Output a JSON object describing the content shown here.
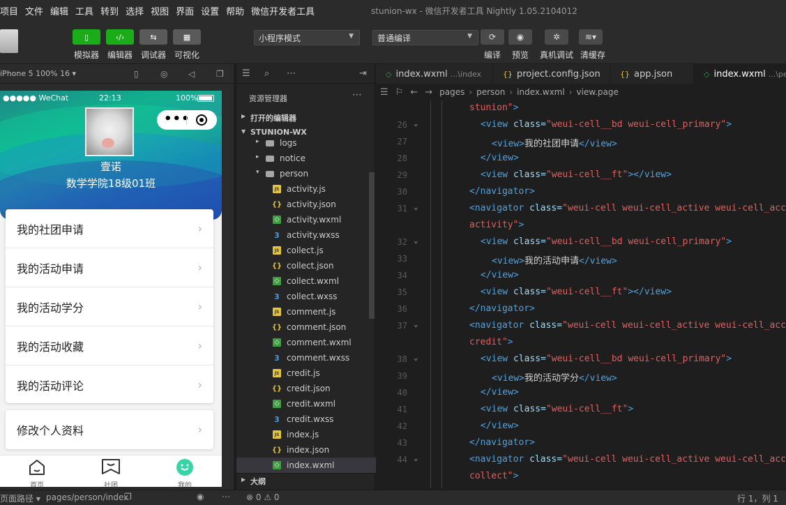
{
  "menubar": {
    "items": [
      "项目",
      "文件",
      "编辑",
      "工具",
      "转到",
      "选择",
      "视图",
      "界面",
      "设置",
      "帮助",
      "微信开发者工具"
    ],
    "title": "stunion-wx - 微信开发者工具 Nightly 1.05.2104012"
  },
  "toolbar": {
    "buttons": [
      {
        "label": "模拟器",
        "icon": "phone-icon",
        "active": true
      },
      {
        "label": "编辑器",
        "icon": "code-icon",
        "active": true
      },
      {
        "label": "调试器",
        "icon": "debug-icon",
        "active": false
      },
      {
        "label": "可视化",
        "icon": "layout-icon",
        "active": false
      }
    ],
    "mode_select": "小程序模式",
    "compile_select": "普通编译",
    "right_buttons": [
      {
        "label": "编译",
        "icon": "refresh-icon"
      },
      {
        "label": "预览",
        "icon": "eye-icon"
      },
      {
        "label": "真机调试",
        "icon": "bug-icon"
      },
      {
        "label": "清缓存",
        "icon": "layers-icon"
      }
    ]
  },
  "simulator": {
    "device": "iPhone 5 100% 16 ▾",
    "status": {
      "carrier": "●●●●● WeChat",
      "time": "22:13",
      "battery": "100%"
    },
    "user": {
      "name": "壹诺",
      "college": "数学学院18级01班"
    },
    "cells": [
      "我的社团申请",
      "我的活动申请",
      "我的活动学分",
      "我的活动收藏",
      "我的活动评论"
    ],
    "cell2": "修改个人资料",
    "tabs": [
      {
        "label": "首页",
        "icon": "home-icon"
      },
      {
        "label": "社团",
        "icon": "club-icon"
      },
      {
        "label": "我的",
        "icon": "profile-icon"
      }
    ],
    "footer": {
      "label": "页面路径 ▾",
      "path": "pages/person/index"
    }
  },
  "explorer": {
    "title": "资源管理器",
    "open_editors": "打开的编辑器",
    "project": "STUNION-WX",
    "outline": "大纲",
    "tree": [
      {
        "name": "logs",
        "type": "folder",
        "indent": 1,
        "caret": "▸"
      },
      {
        "name": "notice",
        "type": "folder",
        "indent": 1,
        "caret": "▸"
      },
      {
        "name": "person",
        "type": "folder-open",
        "indent": 1,
        "caret": "▾"
      },
      {
        "name": "activity.js",
        "type": "js",
        "indent": 2
      },
      {
        "name": "activity.json",
        "type": "json",
        "indent": 2
      },
      {
        "name": "activity.wxml",
        "type": "wxml",
        "indent": 2
      },
      {
        "name": "activity.wxss",
        "type": "wxss",
        "indent": 2
      },
      {
        "name": "collect.js",
        "type": "js",
        "indent": 2
      },
      {
        "name": "collect.json",
        "type": "json",
        "indent": 2
      },
      {
        "name": "collect.wxml",
        "type": "wxml",
        "indent": 2
      },
      {
        "name": "collect.wxss",
        "type": "wxss",
        "indent": 2
      },
      {
        "name": "comment.js",
        "type": "js",
        "indent": 2
      },
      {
        "name": "comment.json",
        "type": "json",
        "indent": 2
      },
      {
        "name": "comment.wxml",
        "type": "wxml",
        "indent": 2
      },
      {
        "name": "comment.wxss",
        "type": "wxss",
        "indent": 2
      },
      {
        "name": "credit.js",
        "type": "js",
        "indent": 2
      },
      {
        "name": "credit.json",
        "type": "json",
        "indent": 2
      },
      {
        "name": "credit.wxml",
        "type": "wxml",
        "indent": 2
      },
      {
        "name": "credit.wxss",
        "type": "wxss",
        "indent": 2
      },
      {
        "name": "index.js",
        "type": "js",
        "indent": 2
      },
      {
        "name": "index.json",
        "type": "json",
        "indent": 2
      },
      {
        "name": "index.wxml",
        "type": "wxml",
        "indent": 2,
        "active": true
      }
    ]
  },
  "editor": {
    "tabs": [
      {
        "name": "index.wxml",
        "path": "...\\index",
        "icon": "wxml"
      },
      {
        "name": "project.config.json",
        "path": "",
        "icon": "json"
      },
      {
        "name": "app.json",
        "path": "",
        "icon": "json"
      },
      {
        "name": "index.wxml",
        "path": "...\\per",
        "icon": "wxml",
        "active": true
      }
    ],
    "breadcrumbs": [
      "pages",
      "person",
      "index.wxml",
      "view.page"
    ],
    "lines": [
      {
        "n": "",
        "indent": 0,
        "parts": [
          {
            "c": "t-str",
            "t": "stunion\""
          },
          {
            "c": "t-tag",
            "t": ">"
          }
        ]
      },
      {
        "n": "26",
        "fold": true,
        "indent": 1,
        "parts": [
          {
            "c": "t-tag",
            "t": "<view "
          },
          {
            "c": "t-attr",
            "t": "class="
          },
          {
            "c": "t-str",
            "t": "\"weui-cell__bd weui-cell_primary\""
          },
          {
            "c": "t-tag",
            "t": ">"
          }
        ]
      },
      {
        "n": "27",
        "indent": 2,
        "parts": [
          {
            "c": "t-tag",
            "t": "<view>"
          },
          {
            "c": "t-text",
            "t": "我的社团申请"
          },
          {
            "c": "t-tag",
            "t": "</view>"
          }
        ]
      },
      {
        "n": "28",
        "indent": 1,
        "parts": [
          {
            "c": "t-tag",
            "t": "</view>"
          }
        ]
      },
      {
        "n": "29",
        "indent": 1,
        "parts": [
          {
            "c": "t-tag",
            "t": "<view "
          },
          {
            "c": "t-attr",
            "t": "class="
          },
          {
            "c": "t-str",
            "t": "\"weui-cell__ft\""
          },
          {
            "c": "t-tag",
            "t": "></view>"
          }
        ]
      },
      {
        "n": "30",
        "indent": 0,
        "parts": [
          {
            "c": "t-tag",
            "t": "</navigator>"
          }
        ]
      },
      {
        "n": "31",
        "fold": true,
        "indent": 0,
        "parts": [
          {
            "c": "t-tag",
            "t": "<navigator "
          },
          {
            "c": "t-attr",
            "t": "class="
          },
          {
            "c": "t-str",
            "t": "\"weui-cell weui-cell_active weui-cell_acce"
          }
        ]
      },
      {
        "n": "",
        "indent": 0,
        "parts": [
          {
            "c": "t-str",
            "t": "activity\""
          },
          {
            "c": "t-tag",
            "t": ">"
          }
        ]
      },
      {
        "n": "32",
        "fold": true,
        "indent": 1,
        "parts": [
          {
            "c": "t-tag",
            "t": "<view "
          },
          {
            "c": "t-attr",
            "t": "class="
          },
          {
            "c": "t-str",
            "t": "\"weui-cell__bd weui-cell_primary\""
          },
          {
            "c": "t-tag",
            "t": ">"
          }
        ]
      },
      {
        "n": "33",
        "indent": 2,
        "parts": [
          {
            "c": "t-tag",
            "t": "<view>"
          },
          {
            "c": "t-text",
            "t": "我的活动申请"
          },
          {
            "c": "t-tag",
            "t": "</view>"
          }
        ]
      },
      {
        "n": "34",
        "indent": 1,
        "parts": [
          {
            "c": "t-tag",
            "t": "</view>"
          }
        ]
      },
      {
        "n": "35",
        "indent": 1,
        "parts": [
          {
            "c": "t-tag",
            "t": "<view "
          },
          {
            "c": "t-attr",
            "t": "class="
          },
          {
            "c": "t-str",
            "t": "\"weui-cell__ft\""
          },
          {
            "c": "t-tag",
            "t": "></view>"
          }
        ]
      },
      {
        "n": "36",
        "indent": 0,
        "parts": [
          {
            "c": "t-tag",
            "t": "</navigator>"
          }
        ]
      },
      {
        "n": "37",
        "fold": true,
        "indent": 0,
        "parts": [
          {
            "c": "t-tag",
            "t": "<navigator "
          },
          {
            "c": "t-attr",
            "t": "class="
          },
          {
            "c": "t-str",
            "t": "\"weui-cell weui-cell_active weui-cell_acce"
          }
        ]
      },
      {
        "n": "",
        "indent": 0,
        "parts": [
          {
            "c": "t-str",
            "t": "credit\""
          },
          {
            "c": "t-tag",
            "t": ">"
          }
        ]
      },
      {
        "n": "38",
        "fold": true,
        "indent": 1,
        "parts": [
          {
            "c": "t-tag",
            "t": "<view "
          },
          {
            "c": "t-attr",
            "t": "class="
          },
          {
            "c": "t-str",
            "t": "\"weui-cell__bd weui-cell_primary\""
          },
          {
            "c": "t-tag",
            "t": ">"
          }
        ]
      },
      {
        "n": "39",
        "indent": 2,
        "parts": [
          {
            "c": "t-tag",
            "t": "<view>"
          },
          {
            "c": "t-text",
            "t": "我的活动学分"
          },
          {
            "c": "t-tag",
            "t": "</view>"
          }
        ]
      },
      {
        "n": "40",
        "indent": 1,
        "parts": [
          {
            "c": "t-tag",
            "t": "</view>"
          }
        ]
      },
      {
        "n": "41",
        "indent": 1,
        "parts": [
          {
            "c": "t-tag",
            "t": "<view "
          },
          {
            "c": "t-attr",
            "t": "class="
          },
          {
            "c": "t-str",
            "t": "\"weui-cell__ft\""
          },
          {
            "c": "t-tag",
            "t": ">"
          }
        ]
      },
      {
        "n": "42",
        "indent": 1,
        "parts": [
          {
            "c": "t-tag",
            "t": "</view>"
          }
        ]
      },
      {
        "n": "43",
        "indent": 0,
        "parts": [
          {
            "c": "t-tag",
            "t": "</navigator>"
          }
        ]
      },
      {
        "n": "44",
        "fold": true,
        "indent": 0,
        "parts": [
          {
            "c": "t-tag",
            "t": "<navigator "
          },
          {
            "c": "t-attr",
            "t": "class="
          },
          {
            "c": "t-str",
            "t": "\"weui-cell weui-cell_active weui-cell_acce"
          }
        ]
      },
      {
        "n": "",
        "indent": 0,
        "parts": [
          {
            "c": "t-str",
            "t": "collect\""
          },
          {
            "c": "t-tag",
            "t": ">"
          }
        ]
      }
    ]
  },
  "statusbar": {
    "problems": "⊗ 0 ⚠ 0",
    "position": "行 1，列 1"
  }
}
